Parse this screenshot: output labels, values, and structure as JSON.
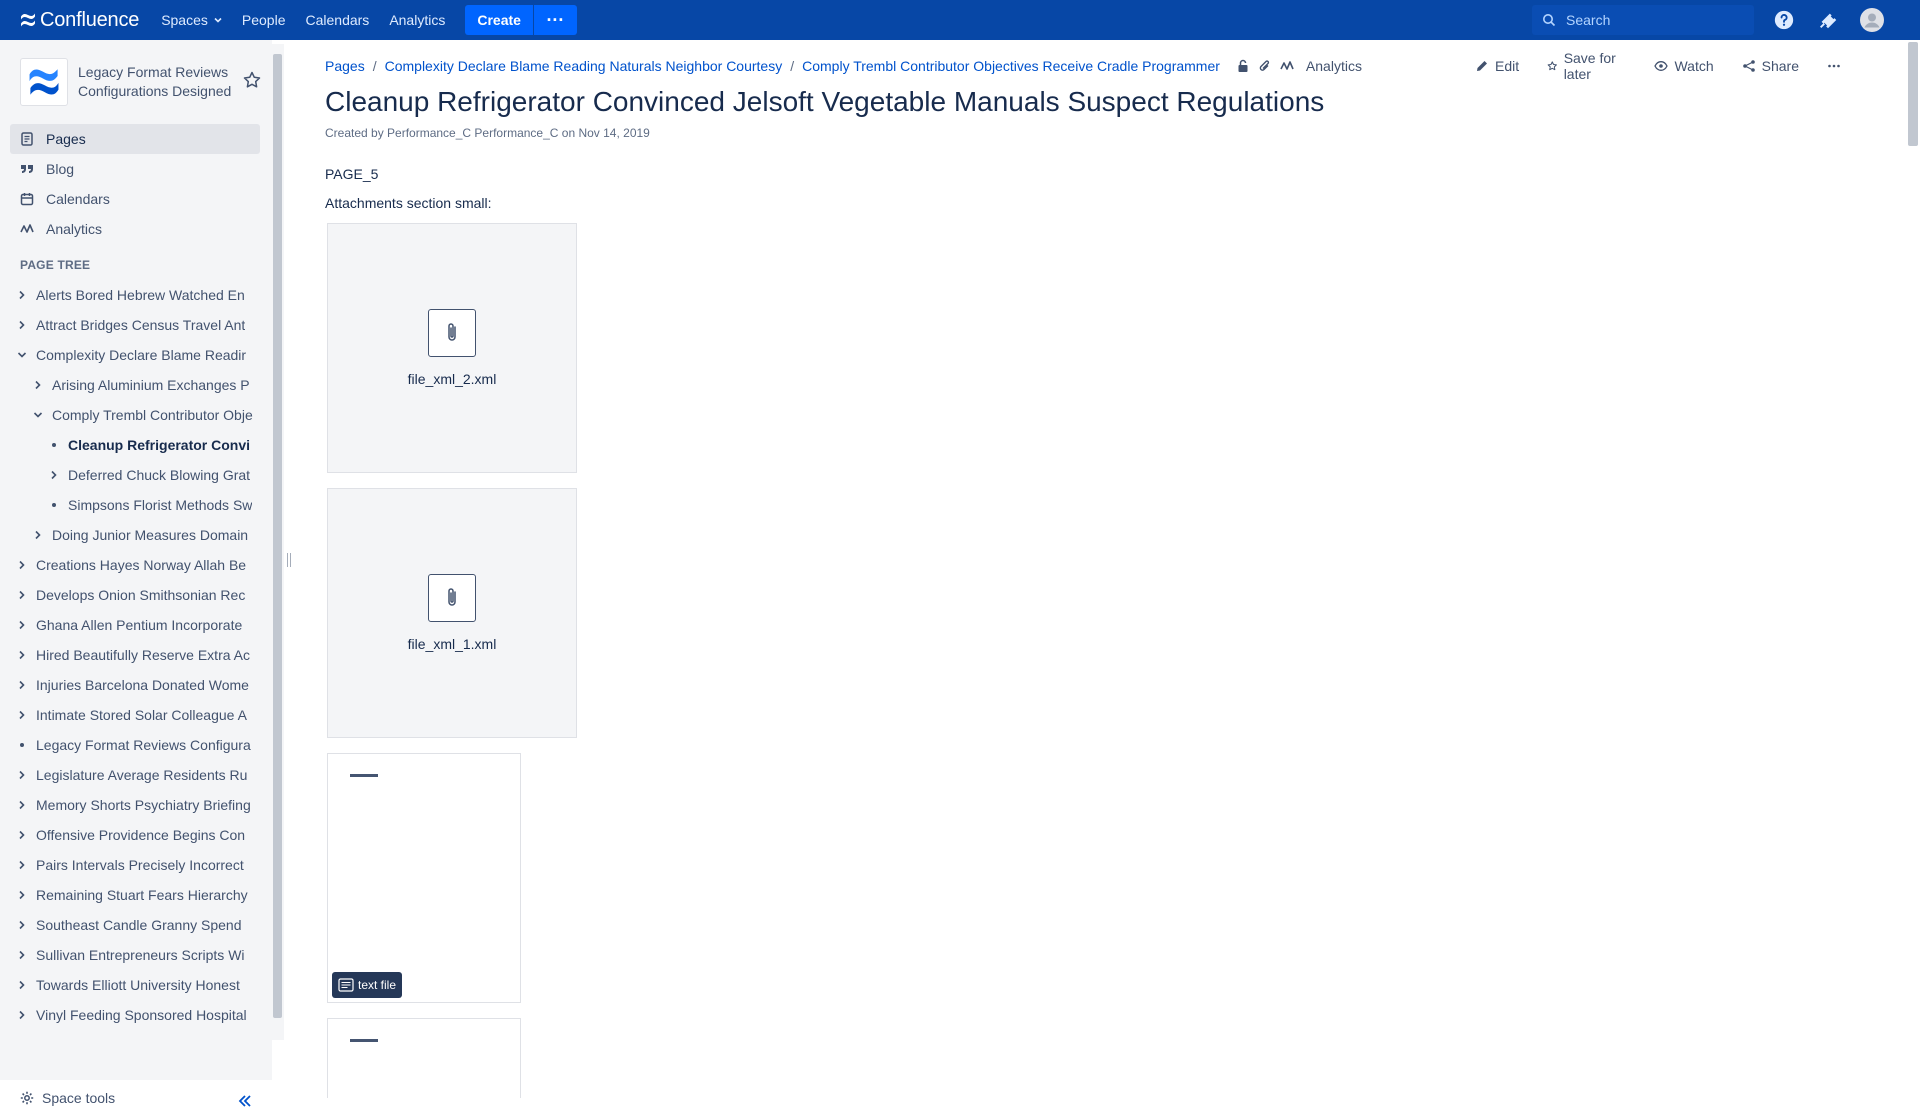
{
  "topnav": {
    "brand": "Confluence",
    "links": [
      "Spaces",
      "People",
      "Calendars",
      "Analytics"
    ],
    "create_label": "Create",
    "more_label": "···",
    "search_placeholder": "Search",
    "colors": {
      "bar": "#0747A6",
      "button": "#0065FF"
    }
  },
  "sidebar": {
    "space_name": "Legacy Format Reviews Configurations Designed",
    "nav": [
      {
        "label": "Pages",
        "icon": "pages-icon"
      },
      {
        "label": "Blog",
        "icon": "quote-icon"
      },
      {
        "label": "Calendars",
        "icon": "calendar-icon"
      },
      {
        "label": "Analytics",
        "icon": "analytics-icon"
      }
    ],
    "tree_title": "PAGE TREE",
    "tree": [
      {
        "label": "Alerts Bored Hebrew Watched En",
        "level": 0,
        "state": "collapsed"
      },
      {
        "label": "Attract Bridges Census Travel Ant",
        "level": 0,
        "state": "collapsed"
      },
      {
        "label": "Complexity Declare Blame Readir",
        "level": 0,
        "state": "expanded"
      },
      {
        "label": "Arising Aluminium Exchanges P",
        "level": 1,
        "state": "collapsed"
      },
      {
        "label": "Comply Trembl Contributor Obje",
        "level": 1,
        "state": "expanded"
      },
      {
        "label": "Cleanup Refrigerator Convi",
        "level": 2,
        "state": "leaf",
        "current": true
      },
      {
        "label": "Deferred Chuck Blowing Grat",
        "level": 2,
        "state": "collapsed"
      },
      {
        "label": "Simpsons Florist Methods Sw",
        "level": 2,
        "state": "leaf"
      },
      {
        "label": "Doing Junior Measures Domain",
        "level": 1,
        "state": "collapsed"
      },
      {
        "label": "Creations Hayes Norway Allah Be",
        "level": 0,
        "state": "collapsed"
      },
      {
        "label": "Develops Onion Smithsonian Rec",
        "level": 0,
        "state": "collapsed"
      },
      {
        "label": "Ghana Allen Pentium Incorporate",
        "level": 0,
        "state": "collapsed"
      },
      {
        "label": "Hired Beautifully Reserve Extra Ac",
        "level": 0,
        "state": "collapsed"
      },
      {
        "label": "Injuries Barcelona Donated Wome",
        "level": 0,
        "state": "collapsed"
      },
      {
        "label": "Intimate Stored Solar Colleague A",
        "level": 0,
        "state": "collapsed"
      },
      {
        "label": "Legacy Format Reviews Configura",
        "level": 0,
        "state": "leaf"
      },
      {
        "label": "Legislature Average Residents Ru",
        "level": 0,
        "state": "collapsed"
      },
      {
        "label": "Memory Shorts Psychiatry Briefing",
        "level": 0,
        "state": "collapsed"
      },
      {
        "label": "Offensive Providence Begins Con",
        "level": 0,
        "state": "collapsed"
      },
      {
        "label": "Pairs Intervals Precisely Incorrect",
        "level": 0,
        "state": "collapsed"
      },
      {
        "label": "Remaining Stuart Fears Hierarchy",
        "level": 0,
        "state": "collapsed"
      },
      {
        "label": "Southeast Candle Granny Spend",
        "level": 0,
        "state": "collapsed"
      },
      {
        "label": "Sullivan Entrepreneurs Scripts Wi",
        "level": 0,
        "state": "collapsed"
      },
      {
        "label": "Towards Elliott University Honest",
        "level": 0,
        "state": "collapsed"
      },
      {
        "label": "Vinyl Feeding Sponsored Hospital",
        "level": 0,
        "state": "collapsed"
      }
    ],
    "space_tools": "Space tools"
  },
  "page": {
    "breadcrumbs": [
      "Pages",
      "Complexity Declare Blame Reading Naturals Neighbor Courtesy",
      "Comply Trembl Contributor Objectives Receive Cradle Programmer"
    ],
    "analytics_label": "Analytics",
    "actions": [
      "Edit",
      "Save for later",
      "Watch",
      "Share"
    ],
    "title": "Cleanup Refrigerator Convinced Jelsoft Vegetable Manuals Suspect Regulations",
    "byline": "Created by Performance_C Performance_C on Nov 14, 2019",
    "body_line1": "PAGE_5",
    "body_line2": "Attachments section small:",
    "attachments": [
      "file_xml_2.xml",
      "file_xml_1.xml"
    ],
    "file_tag": "text file"
  }
}
